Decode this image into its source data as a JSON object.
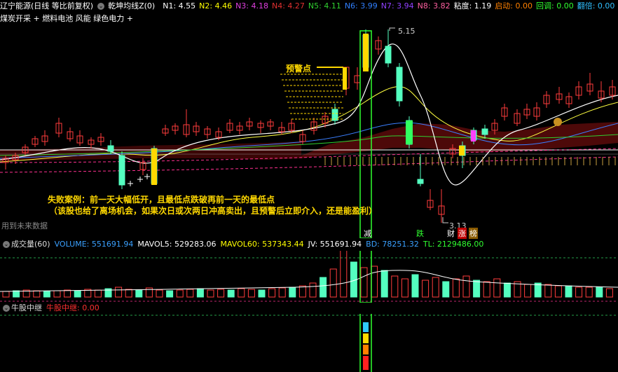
{
  "header": {
    "stock_title": "辽宁能源(日线 等比前复权)",
    "indicator_name": "乾坤均线Z(0)",
    "n_values": [
      {
        "label": "N1: 4.55",
        "color": "#ffffff"
      },
      {
        "label": "N2: 4.46",
        "color": "#ffff00"
      },
      {
        "label": "N3: 4.18",
        "color": "#e040e0"
      },
      {
        "label": "N4: 4.27",
        "color": "#e03030"
      },
      {
        "label": "N5: 4.11",
        "color": "#30d030"
      },
      {
        "label": "N6: 3.99",
        "color": "#3080ff"
      },
      {
        "label": "N7: 3.94",
        "color": "#9040ff"
      },
      {
        "label": "N8: 3.82",
        "color": "#ff60a0"
      },
      {
        "label": "粘度: 1.19",
        "color": "#ffffff"
      },
      {
        "label": "启动: 0.00",
        "color": "#ff8000"
      },
      {
        "label": "回调: 0.00",
        "color": "#30ff30"
      },
      {
        "label": "翻倍: 0.00",
        "color": "#30c0ff"
      }
    ],
    "concepts": "煤炭开采 + 燃料电池 风能 绿色电力 +"
  },
  "annotations": {
    "warning_point": "预警点",
    "failure_line1": "失败案例：前一天大幅低开，且最低点跌破再前一天的最低点",
    "failure_line2": "（该股也给了离场机会，如果次日或次两日冲高卖出，且预警后立即介入，还是能盈利）",
    "future_data": "用到未来数据",
    "high_price": "5.15",
    "low_price": "3.13"
  },
  "signals": [
    {
      "text": "减",
      "color": "#ffffff"
    },
    {
      "text": "跌",
      "color": "#30ff30"
    },
    {
      "text": "财",
      "color": "#ffffff"
    },
    {
      "text": "涨",
      "color": "#ff3030"
    },
    {
      "text": "榜",
      "color": "#ffffff"
    }
  ],
  "volume_header": {
    "title": "成交量(60)",
    "volume": {
      "label": "VOLUME: 551691.94",
      "color": "#3aa0ff"
    },
    "mavol5": {
      "label": "MAVOL5: 529283.06",
      "color": "#ffffff"
    },
    "mavol60": {
      "label": "MAVOL60: 537343.44",
      "color": "#ffff00"
    },
    "jv": {
      "label": "JV: 551691.94",
      "color": "#ffffff"
    },
    "bd": {
      "label": "BD: 78251.32",
      "color": "#3aa0ff"
    },
    "tl": {
      "label": "TL: 2129486.00",
      "color": "#30ff30"
    }
  },
  "relay_header": {
    "title": "牛股中继",
    "value": {
      "label": "牛股中继: 0.00",
      "color": "#ff3030"
    }
  },
  "colors": {
    "up": "#ff3c3c",
    "down": "#54ffc0",
    "highlight_box": "#30ff30",
    "warning_bar": "#ffd800"
  }
}
